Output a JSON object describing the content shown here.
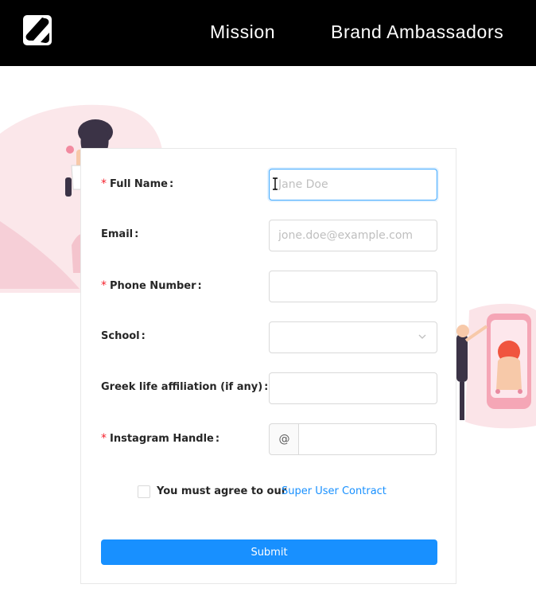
{
  "header": {
    "nav": {
      "mission": "Mission",
      "brand_ambassadors": "Brand Ambassadors"
    },
    "logo_icon": "s-logo-icon"
  },
  "form": {
    "full_name": {
      "label": "Full Name",
      "placeholder": "Jane Doe",
      "required": true
    },
    "email": {
      "label": "Email",
      "placeholder": "jone.doe@example.com",
      "required": false
    },
    "phone": {
      "label": "Phone Number",
      "placeholder": "",
      "required": true
    },
    "school": {
      "label": "School",
      "selected": "",
      "required": false
    },
    "greek": {
      "label": "Greek life affiliation (if any)",
      "placeholder": "",
      "required": false
    },
    "instagram": {
      "label": "Instagram Handle",
      "prefix": "@",
      "placeholder": "",
      "required": true
    },
    "agree": {
      "text": "You must agree to our",
      "link": "Super User Contract",
      "checked": false
    },
    "submit_label": "Submit",
    "required_mark": "*",
    "colon": ":"
  },
  "colors": {
    "header_bg": "#000000",
    "primary": "#1890ff",
    "required": "#f5222d",
    "illustration_pink": "#f9dde3"
  }
}
